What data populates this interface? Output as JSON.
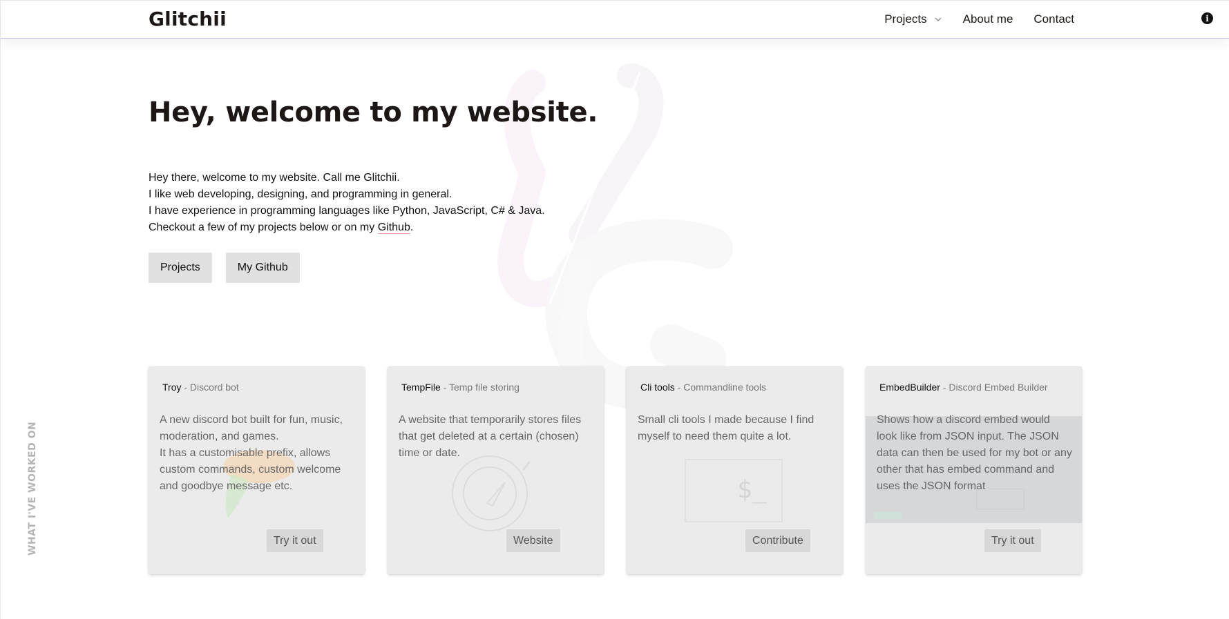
{
  "navbar": {
    "brand": "Glitchii",
    "links": [
      {
        "label": "Projects",
        "has_dropdown": true
      },
      {
        "label": "About me",
        "has_dropdown": false
      },
      {
        "label": "Contact",
        "has_dropdown": false
      }
    ],
    "info_icon": "info-icon"
  },
  "hero": {
    "title": "Hey, welcome to my website.",
    "lines": [
      "Hey there, welcome to my website. Call me Glitchii.",
      "I like web developing, designing, and programming in general.",
      "I have experience in programming languages like Python, JavaScript, C# & Java."
    ],
    "last_line_prefix": "Checkout a few of my projects below or on my ",
    "github_link": "Github",
    "last_line_suffix": ".",
    "buttons": [
      "Projects",
      "My Github"
    ]
  },
  "side_label": "WHAT I'VE WORKED ON",
  "cards": [
    {
      "name": "Troy",
      "subtitle": " - Discord bot",
      "description": "A new discord bot built for fun, music, moderation, and games.\nIt has a customisable prefix, allows custom commands, custom welcome and goodbye message etc.",
      "button": "Try it out"
    },
    {
      "name": "TempFile",
      "subtitle": " - Temp file storing",
      "description": "A website that temporarily stores files that get deleted at a certain (chosen) time or date.",
      "button": "Website"
    },
    {
      "name": "Cli tools",
      "subtitle": " - Commandline tools",
      "description": "Small cli tools I made because I find myself to need them quite a lot.",
      "button": "Contribute"
    },
    {
      "name": "EmbedBuilder",
      "subtitle": " - Discord Embed Builder",
      "description": "Shows how a discord embed would look like from JSON input. The JSON data can then be used for my bot or any other that has embed command and uses the JSON format",
      "button": "Try it out"
    }
  ],
  "colors": {
    "text": "#1c1714",
    "button_bg": "#e1e1e1",
    "card_bg": "#e9eaeb",
    "link_underline": "#f09aa0",
    "navbar_border": "#c9c3e6"
  }
}
